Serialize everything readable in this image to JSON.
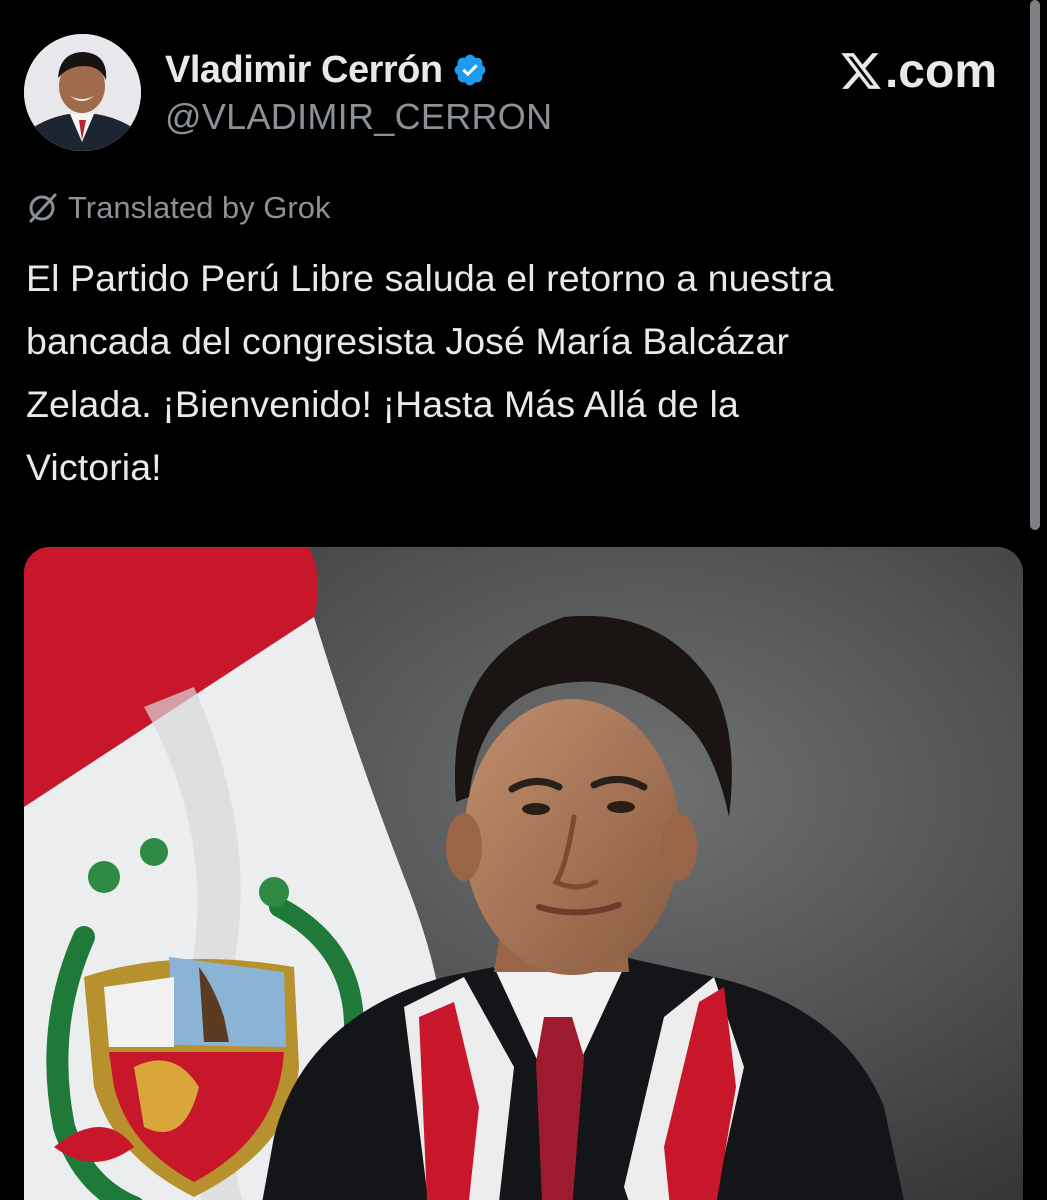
{
  "author": {
    "display_name": "Vladimir Cerrón",
    "handle": "@VLADIMIR_CERRON",
    "verified": true,
    "avatar_icon": "profile-photo"
  },
  "brand": {
    "label": ".com",
    "logo_icon": "x-logo-icon"
  },
  "translation": {
    "label": "Translated by Grok",
    "icon": "grok-icon"
  },
  "tweet": {
    "lines": [
      "El Partido Perú Libre saluda el retorno a nuestra",
      "bancada del congresista José María Balcázar",
      "Zelada. ¡Bienvenido! ¡Hasta Más Allá de la",
      "Victoria!"
    ]
  },
  "media": {
    "type": "photo",
    "subject": "portrait-with-peruvian-flag"
  },
  "colors": {
    "background": "#000000",
    "text_primary": "#e7e9ea",
    "text_secondary": "#8b9197",
    "verified_blue": "#1d9bf0"
  }
}
